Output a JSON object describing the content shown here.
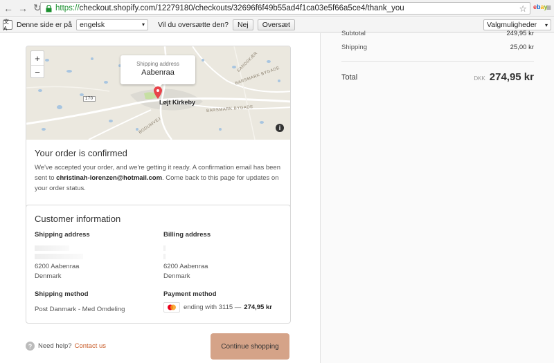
{
  "browser": {
    "url_scheme": "https://",
    "url_rest": "checkout.shopify.com/12279180/checkouts/32696f6f49b55ad4f1ca03e5f66a5ce4/thank_you",
    "ebay_label": "ebay"
  },
  "translate_bar": {
    "prefix": "Denne side er på",
    "language": "engelsk",
    "question": "Vil du oversætte den?",
    "no_button": "Nej",
    "translate_button": "Oversæt",
    "options": "Valgmuligheder"
  },
  "map": {
    "popup_label": "Shipping address",
    "popup_city": "Aabenraa",
    "town_label": "Løjt Kirkeby",
    "road_a": "BARSMARK BYGADE",
    "road_b": "SANDSKÆR",
    "road_c": "BARSMARK BYGADE",
    "road_d": "BODUMVEJ",
    "road_e": "170"
  },
  "confirmation": {
    "title": "Your order is confirmed",
    "text_before": "We've accepted your order, and we're getting it ready. A confirmation email has been sent to ",
    "email": "christinah-lorenzen@hotmail.com",
    "text_after": ". Come back to this page for updates on your order status."
  },
  "customer": {
    "title": "Customer information",
    "shipping_address_label": "Shipping address",
    "shipping_city": "6200 Aabenraa",
    "shipping_country": "Denmark",
    "billing_address_label": "Billing address",
    "billing_city": "6200 Aabenraa",
    "billing_country": "Denmark",
    "shipping_method_label": "Shipping method",
    "shipping_method": "Post Danmark - Med Omdeling",
    "payment_method_label": "Payment method",
    "payment_text": "ending with 3115 —",
    "payment_amount": "274,95 kr"
  },
  "footer": {
    "help_text": "Need help?",
    "contact_link": "Contact us",
    "continue_button": "Continue shopping"
  },
  "summary": {
    "subtotal_label": "Subtotal",
    "subtotal_value": "249,95 kr",
    "shipping_label": "Shipping",
    "shipping_value": "25,00 kr",
    "total_label": "Total",
    "currency": "DKK",
    "total_value": "274,95 kr"
  },
  "colors": {
    "accent": "#d5a388",
    "link": "#c85a26",
    "pin": "#e8434a"
  }
}
